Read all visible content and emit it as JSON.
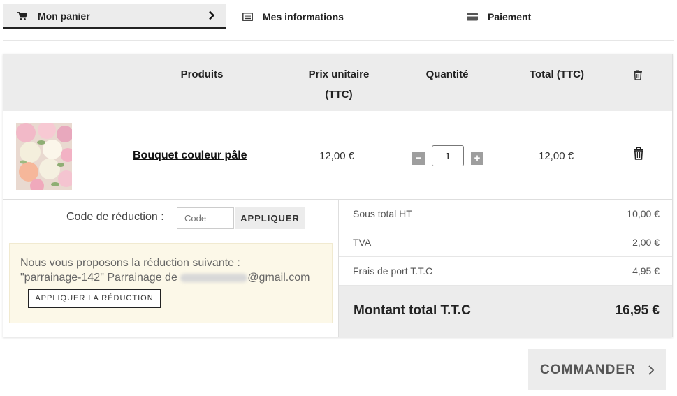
{
  "steps": [
    {
      "label": "Mon panier",
      "icon": "cart-icon",
      "active": true
    },
    {
      "label": "Mes informations",
      "icon": "list-icon",
      "active": false
    },
    {
      "label": "Paiement",
      "icon": "credit-card-icon",
      "active": false
    }
  ],
  "table": {
    "headers": {
      "products": "Produits",
      "unit_price": "Prix unitaire\n(TTC)",
      "quantity": "Quantité",
      "total": "Total (TTC)",
      "delete_icon": "trash-icon"
    },
    "items": [
      {
        "name": "Bouquet couleur pâle",
        "unit_price": "12,00 €",
        "quantity": "1",
        "total": "12,00 €"
      }
    ]
  },
  "coupon": {
    "label": "Code de réduction :",
    "placeholder": "Code",
    "apply_button": "APPLIQUER"
  },
  "promo": {
    "line1": "Nous vous proposons la réduction suivante :",
    "line2_prefix": "\"parrainage-142\" Parrainage de ",
    "line2_suffix": "@gmail.com",
    "button": "APPLIQUER LA RÉDUCTION"
  },
  "totals": {
    "subtotal_label": "Sous total HT",
    "subtotal_value": "10,00 €",
    "tax_label": "TVA",
    "tax_value": "2,00 €",
    "shipping_label": "Frais de port T.T.C",
    "shipping_value": "4,95 €",
    "grand_label": "Montant total T.T.C",
    "grand_value": "16,95 €"
  },
  "order_button": "COMMANDER",
  "colors": {
    "panel_grey": "#ececec",
    "promo_bg": "#fcf8e8",
    "text_dark": "#222222"
  }
}
